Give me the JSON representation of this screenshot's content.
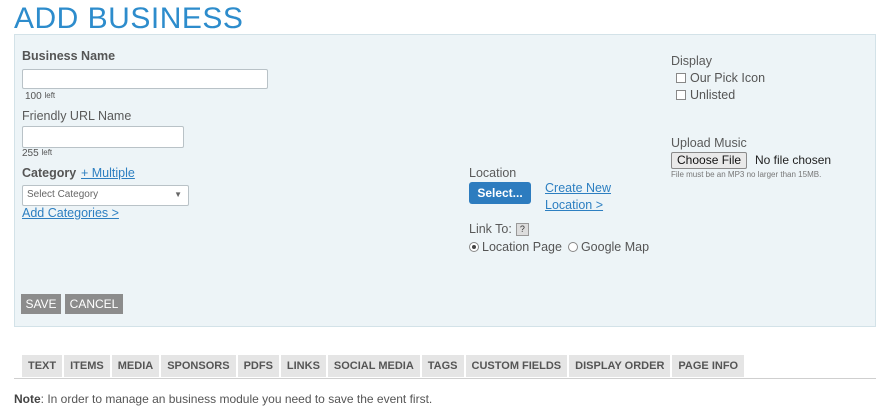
{
  "page": {
    "title": "ADD BUSINESS"
  },
  "form": {
    "business_name": {
      "label": "Business Name",
      "value": "",
      "counter_num": "100",
      "counter_unit": "left"
    },
    "friendly_url": {
      "label": "Friendly URL Name",
      "value": "",
      "counter_num": "255",
      "counter_unit": "left"
    },
    "category": {
      "label": "Category",
      "multiple_link": "+ Multiple",
      "select_value": "Select Category",
      "add_link": "Add Categories >"
    },
    "location": {
      "label": "Location",
      "select_button": "Select...",
      "create_link_line1": "Create New",
      "create_link_line2": "Location >",
      "link_to_label": "Link To:",
      "help_icon": "?",
      "options": [
        {
          "label": "Location Page",
          "checked": true
        },
        {
          "label": "Google Map",
          "checked": false
        }
      ]
    },
    "display": {
      "label": "Display",
      "options": [
        {
          "label": "Our Pick Icon",
          "checked": false
        },
        {
          "label": "Unlisted",
          "checked": false
        }
      ]
    },
    "music": {
      "label": "Upload Music",
      "button": "Choose File",
      "status": "No file chosen",
      "hint": "File must be an MP3 no larger than 15MB."
    },
    "buttons": {
      "save": "SAVE",
      "cancel": "CANCEL"
    }
  },
  "tabs": [
    "TEXT",
    "ITEMS",
    "MEDIA",
    "SPONSORS",
    "PDFS",
    "LINKS",
    "SOCIAL MEDIA",
    "TAGS",
    "CUSTOM FIELDS",
    "DISPLAY ORDER",
    "PAGE INFO"
  ],
  "note": {
    "prefix": "Note",
    "text": ": In order to manage an business module you need to save the event first."
  },
  "colors": {
    "accent": "#2d8ccc",
    "panel_bg": "#edf4f7",
    "button_blue": "#2d7cbf",
    "button_gray": "#8c8c8c"
  }
}
